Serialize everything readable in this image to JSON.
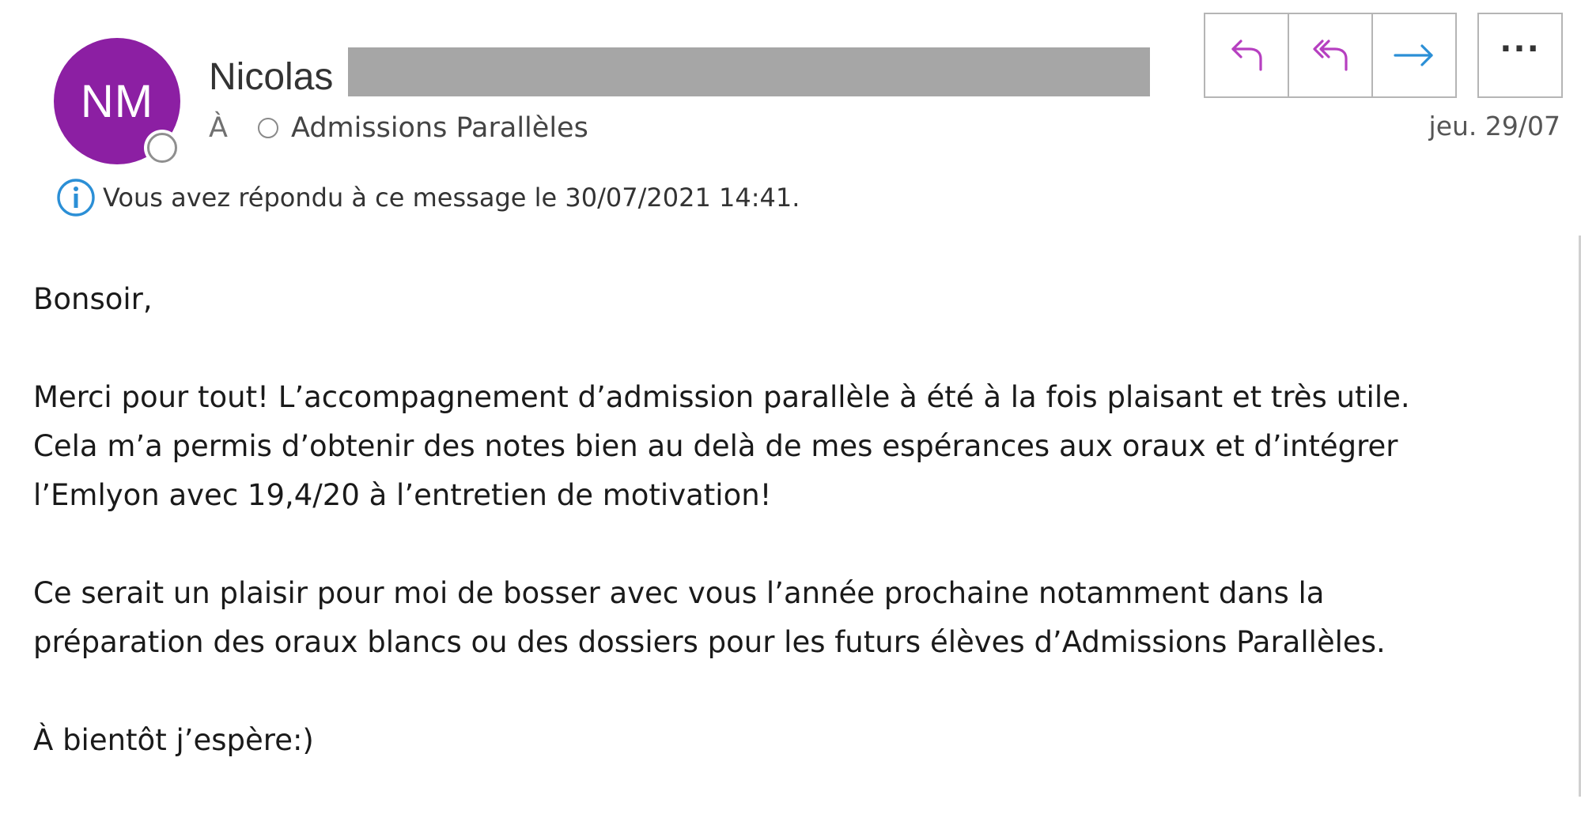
{
  "header": {
    "avatar_initials": "NM",
    "avatar_color": "#8c1fa3",
    "sender_first_name": "Nicolas",
    "to_label": "À",
    "recipient": "Admissions Parallèles",
    "date": "jeu. 29/07",
    "actions": {
      "reply_icon": "reply-icon",
      "reply_all_icon": "reply-all-icon",
      "forward_icon": "forward-icon",
      "more_label": "···"
    },
    "info_message": "Vous avez répondu à ce message le 30/07/2021 14:41."
  },
  "body": {
    "greeting": "Bonsoir,",
    "paragraph1": [
      "Merci pour tout! L’accompagnement d’admission parallèle à été à la fois plaisant et très utile.",
      "Cela m’a permis d’obtenir des notes bien au delà de mes espérances aux oraux et d’intégrer",
      "l’Emlyon avec 19,4/20 à l’entretien de motivation!"
    ],
    "paragraph2": [
      "Ce serait un plaisir pour moi de bosser avec vous l’année prochaine notamment dans la",
      "préparation des oraux blancs ou des dossiers pour les futurs élèves d’Admissions Parallèles."
    ],
    "closing": "À bientôt j’espère:)"
  },
  "colors": {
    "reply_icon": "#b63fc0",
    "forward_icon": "#2b8fd6",
    "info_icon": "#2b8fd6"
  }
}
